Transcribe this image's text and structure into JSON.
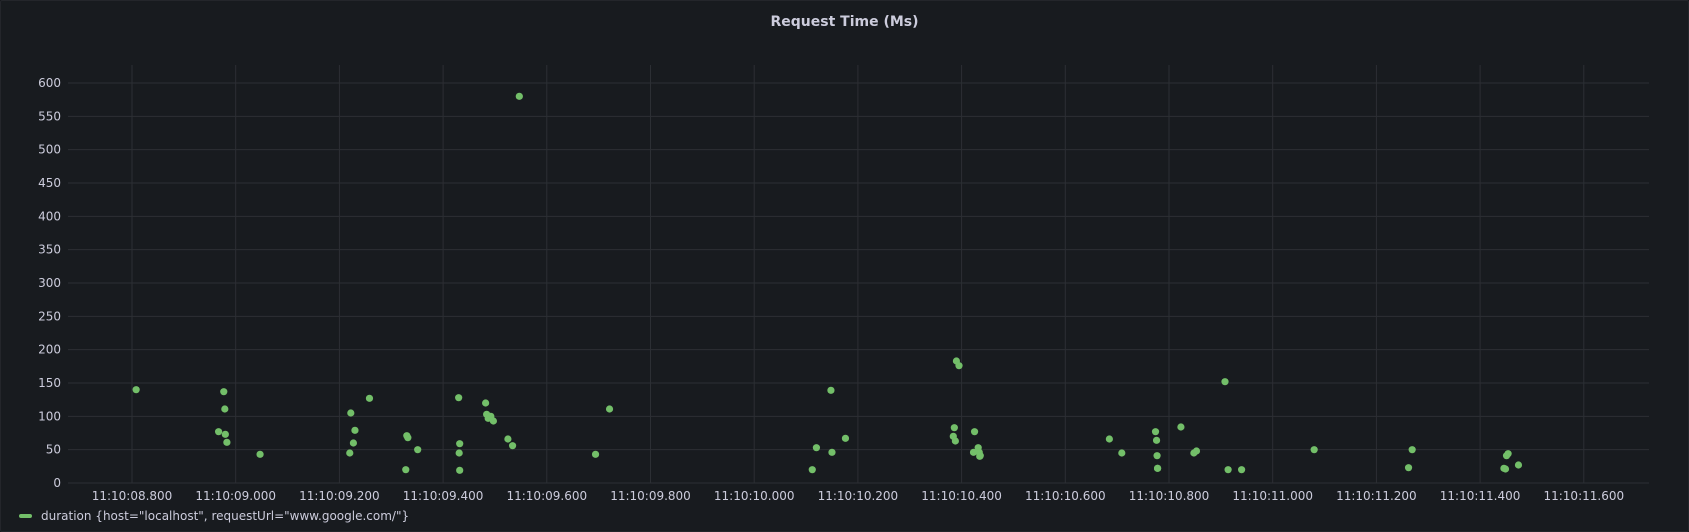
{
  "panel": {
    "title": "Request Time (Ms)"
  },
  "legend": {
    "label": "duration {host=\"localhost\", requestUrl=\"www.google.com/\"}"
  },
  "colors": {
    "series": "#73bf69",
    "grid": "#2c2f34",
    "background": "#181b1f"
  },
  "chart_data": {
    "type": "scatter",
    "title": "Request Time (Ms)",
    "xlabel": "",
    "ylabel": "",
    "x_ticks": [
      "11:10:08.800",
      "11:10:09.000",
      "11:10:09.200",
      "11:10:09.400",
      "11:10:09.600",
      "11:10:09.800",
      "11:10:10.000",
      "11:10:10.200",
      "11:10:10.400",
      "11:10:10.600",
      "11:10:10.800",
      "11:10:11.000",
      "11:10:11.200",
      "11:10:11.400",
      "11:10:11.600"
    ],
    "y_ticks": [
      0,
      50,
      100,
      150,
      200,
      250,
      300,
      350,
      400,
      450,
      500,
      550,
      600
    ],
    "ylim": [
      0,
      600
    ],
    "grid": true,
    "legend_position": "bottom-left",
    "series": [
      {
        "name": "duration {host=\"localhost\", requestUrl=\"www.google.com/\"}",
        "x": [
          "11:10:08.808",
          "11:10:08.967",
          "11:10:08.977",
          "11:10:08.979",
          "11:10:08.980",
          "11:10:08.983",
          "11:10:09.047",
          "11:10:09.220",
          "11:10:09.222",
          "11:10:09.227",
          "11:10:09.230",
          "11:10:09.258",
          "11:10:09.328",
          "11:10:09.330",
          "11:10:09.332",
          "11:10:09.351",
          "11:10:09.430",
          "11:10:09.431",
          "11:10:09.432",
          "11:10:09.432",
          "11:10:09.482",
          "11:10:09.484",
          "11:10:09.487",
          "11:10:09.492",
          "11:10:09.497",
          "11:10:09.525",
          "11:10:09.534",
          "11:10:09.547",
          "11:10:09.694",
          "11:10:09.721",
          "11:10:10.112",
          "11:10:10.120",
          "11:10:10.148",
          "11:10:10.150",
          "11:10:10.176",
          "11:10:10.384",
          "11:10:10.386",
          "11:10:10.388",
          "11:10:10.390",
          "11:10:10.395",
          "11:10:10.423",
          "11:10:10.425",
          "11:10:10.432",
          "11:10:10.434",
          "11:10:10.435",
          "11:10:10.436",
          "11:10:10.685",
          "11:10:10.709",
          "11:10:10.774",
          "11:10:10.776",
          "11:10:10.777",
          "11:10:10.778",
          "11:10:10.778",
          "11:10:10.823",
          "11:10:10.848",
          "11:10:10.853",
          "11:10:10.908",
          "11:10:10.914",
          "11:10:10.940",
          "11:10:11.080",
          "11:10:11.262",
          "11:10:11.269",
          "11:10:11.446",
          "11:10:11.449",
          "11:10:11.451",
          "11:10:11.454",
          "11:10:11.474"
        ],
        "y": [
          140,
          77,
          137,
          111,
          73,
          61,
          43,
          45,
          105,
          60,
          79,
          127,
          20,
          71,
          68,
          50,
          128,
          45,
          59,
          19,
          120,
          103,
          97,
          100,
          93,
          66,
          56,
          580,
          43,
          111,
          20,
          53,
          139,
          46,
          67,
          70,
          83,
          63,
          183,
          176,
          46,
          77,
          53,
          46,
          40,
          41,
          66,
          45,
          77,
          64,
          41,
          22,
          22,
          84,
          45,
          48,
          152,
          20,
          20,
          50,
          23,
          50,
          22,
          21,
          41,
          44,
          27
        ]
      }
    ]
  }
}
